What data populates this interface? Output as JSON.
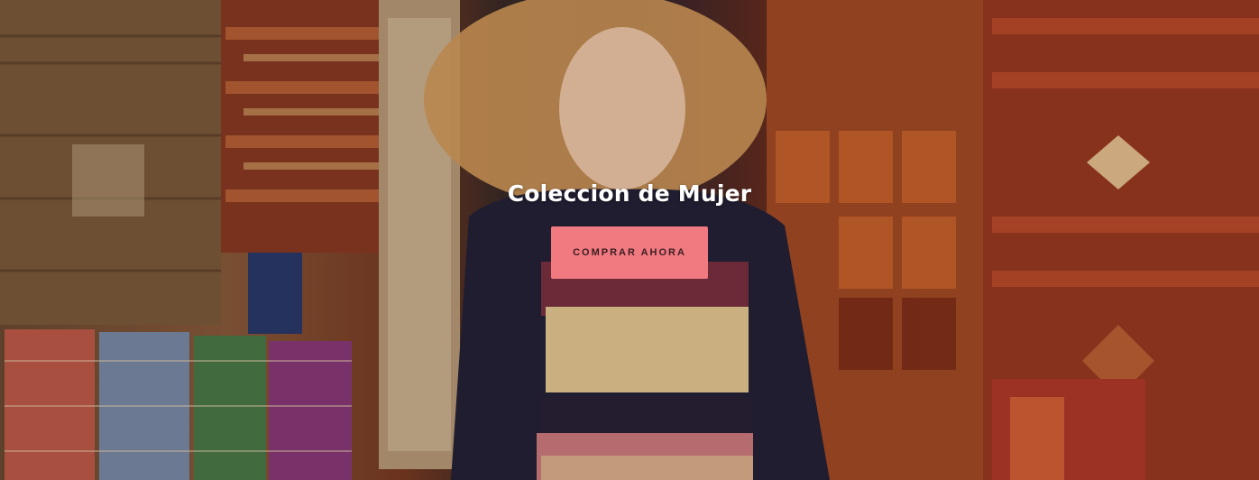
{
  "hero": {
    "title": "Coleccion de Mujer",
    "cta_label": "COMPRAR AHORA",
    "colors": {
      "button_bg": "#f07a80",
      "title": "#ffffff"
    },
    "image_subject": "woman-in-knit-sweater-rug-market"
  }
}
